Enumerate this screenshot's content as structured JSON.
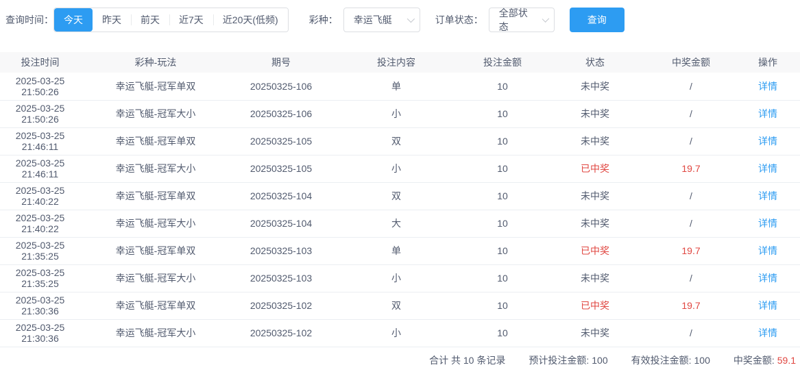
{
  "filters": {
    "time_label": "查询时间：",
    "time_options": [
      {
        "label": "今天",
        "selected": true
      },
      {
        "label": "昨天",
        "selected": false
      },
      {
        "label": "前天",
        "selected": false
      },
      {
        "label": "近7天",
        "selected": false
      },
      {
        "label": "近20天(低频)",
        "selected": false
      }
    ],
    "lottery_label": "彩种：",
    "lottery_value": "幸运飞艇",
    "status_label": "订单状态：",
    "status_value": "全部状态",
    "query_button": "查询"
  },
  "table": {
    "headers": [
      "投注时间",
      "彩种-玩法",
      "期号",
      "投注内容",
      "投注金额",
      "状态",
      "中奖金额",
      "操作"
    ],
    "action_label": "详情",
    "rows": [
      {
        "time": "2025-03-25 21:50:26",
        "play": "幸运飞艇-冠军单双",
        "issue": "20250325-106",
        "content": "单",
        "amount": "10",
        "status": "未中奖",
        "win": "/",
        "won": false
      },
      {
        "time": "2025-03-25 21:50:26",
        "play": "幸运飞艇-冠军大小",
        "issue": "20250325-106",
        "content": "小",
        "amount": "10",
        "status": "未中奖",
        "win": "/",
        "won": false
      },
      {
        "time": "2025-03-25 21:46:11",
        "play": "幸运飞艇-冠军单双",
        "issue": "20250325-105",
        "content": "双",
        "amount": "10",
        "status": "未中奖",
        "win": "/",
        "won": false
      },
      {
        "time": "2025-03-25 21:46:11",
        "play": "幸运飞艇-冠军大小",
        "issue": "20250325-105",
        "content": "小",
        "amount": "10",
        "status": "已中奖",
        "win": "19.7",
        "won": true
      },
      {
        "time": "2025-03-25 21:40:22",
        "play": "幸运飞艇-冠军单双",
        "issue": "20250325-104",
        "content": "双",
        "amount": "10",
        "status": "未中奖",
        "win": "/",
        "won": false
      },
      {
        "time": "2025-03-25 21:40:22",
        "play": "幸运飞艇-冠军大小",
        "issue": "20250325-104",
        "content": "大",
        "amount": "10",
        "status": "未中奖",
        "win": "/",
        "won": false
      },
      {
        "time": "2025-03-25 21:35:25",
        "play": "幸运飞艇-冠军单双",
        "issue": "20250325-103",
        "content": "单",
        "amount": "10",
        "status": "已中奖",
        "win": "19.7",
        "won": true
      },
      {
        "time": "2025-03-25 21:35:25",
        "play": "幸运飞艇-冠军大小",
        "issue": "20250325-103",
        "content": "小",
        "amount": "10",
        "status": "未中奖",
        "win": "/",
        "won": false
      },
      {
        "time": "2025-03-25 21:30:36",
        "play": "幸运飞艇-冠军单双",
        "issue": "20250325-102",
        "content": "双",
        "amount": "10",
        "status": "已中奖",
        "win": "19.7",
        "won": true
      },
      {
        "time": "2025-03-25 21:30:36",
        "play": "幸运飞艇-冠军大小",
        "issue": "20250325-102",
        "content": "小",
        "amount": "10",
        "status": "未中奖",
        "win": "/",
        "won": false
      }
    ]
  },
  "summary": {
    "total": "合计 共 10 条记录",
    "expected_label": "预计投注金额:",
    "expected_value": "100",
    "valid_label": "有效投注金额:",
    "valid_value": "100",
    "win_label": "中奖金额:",
    "win_value": "59.1"
  },
  "colors": {
    "primary": "#2d9cf2",
    "danger": "#e0453f",
    "header_bg": "#f8f8f9"
  }
}
